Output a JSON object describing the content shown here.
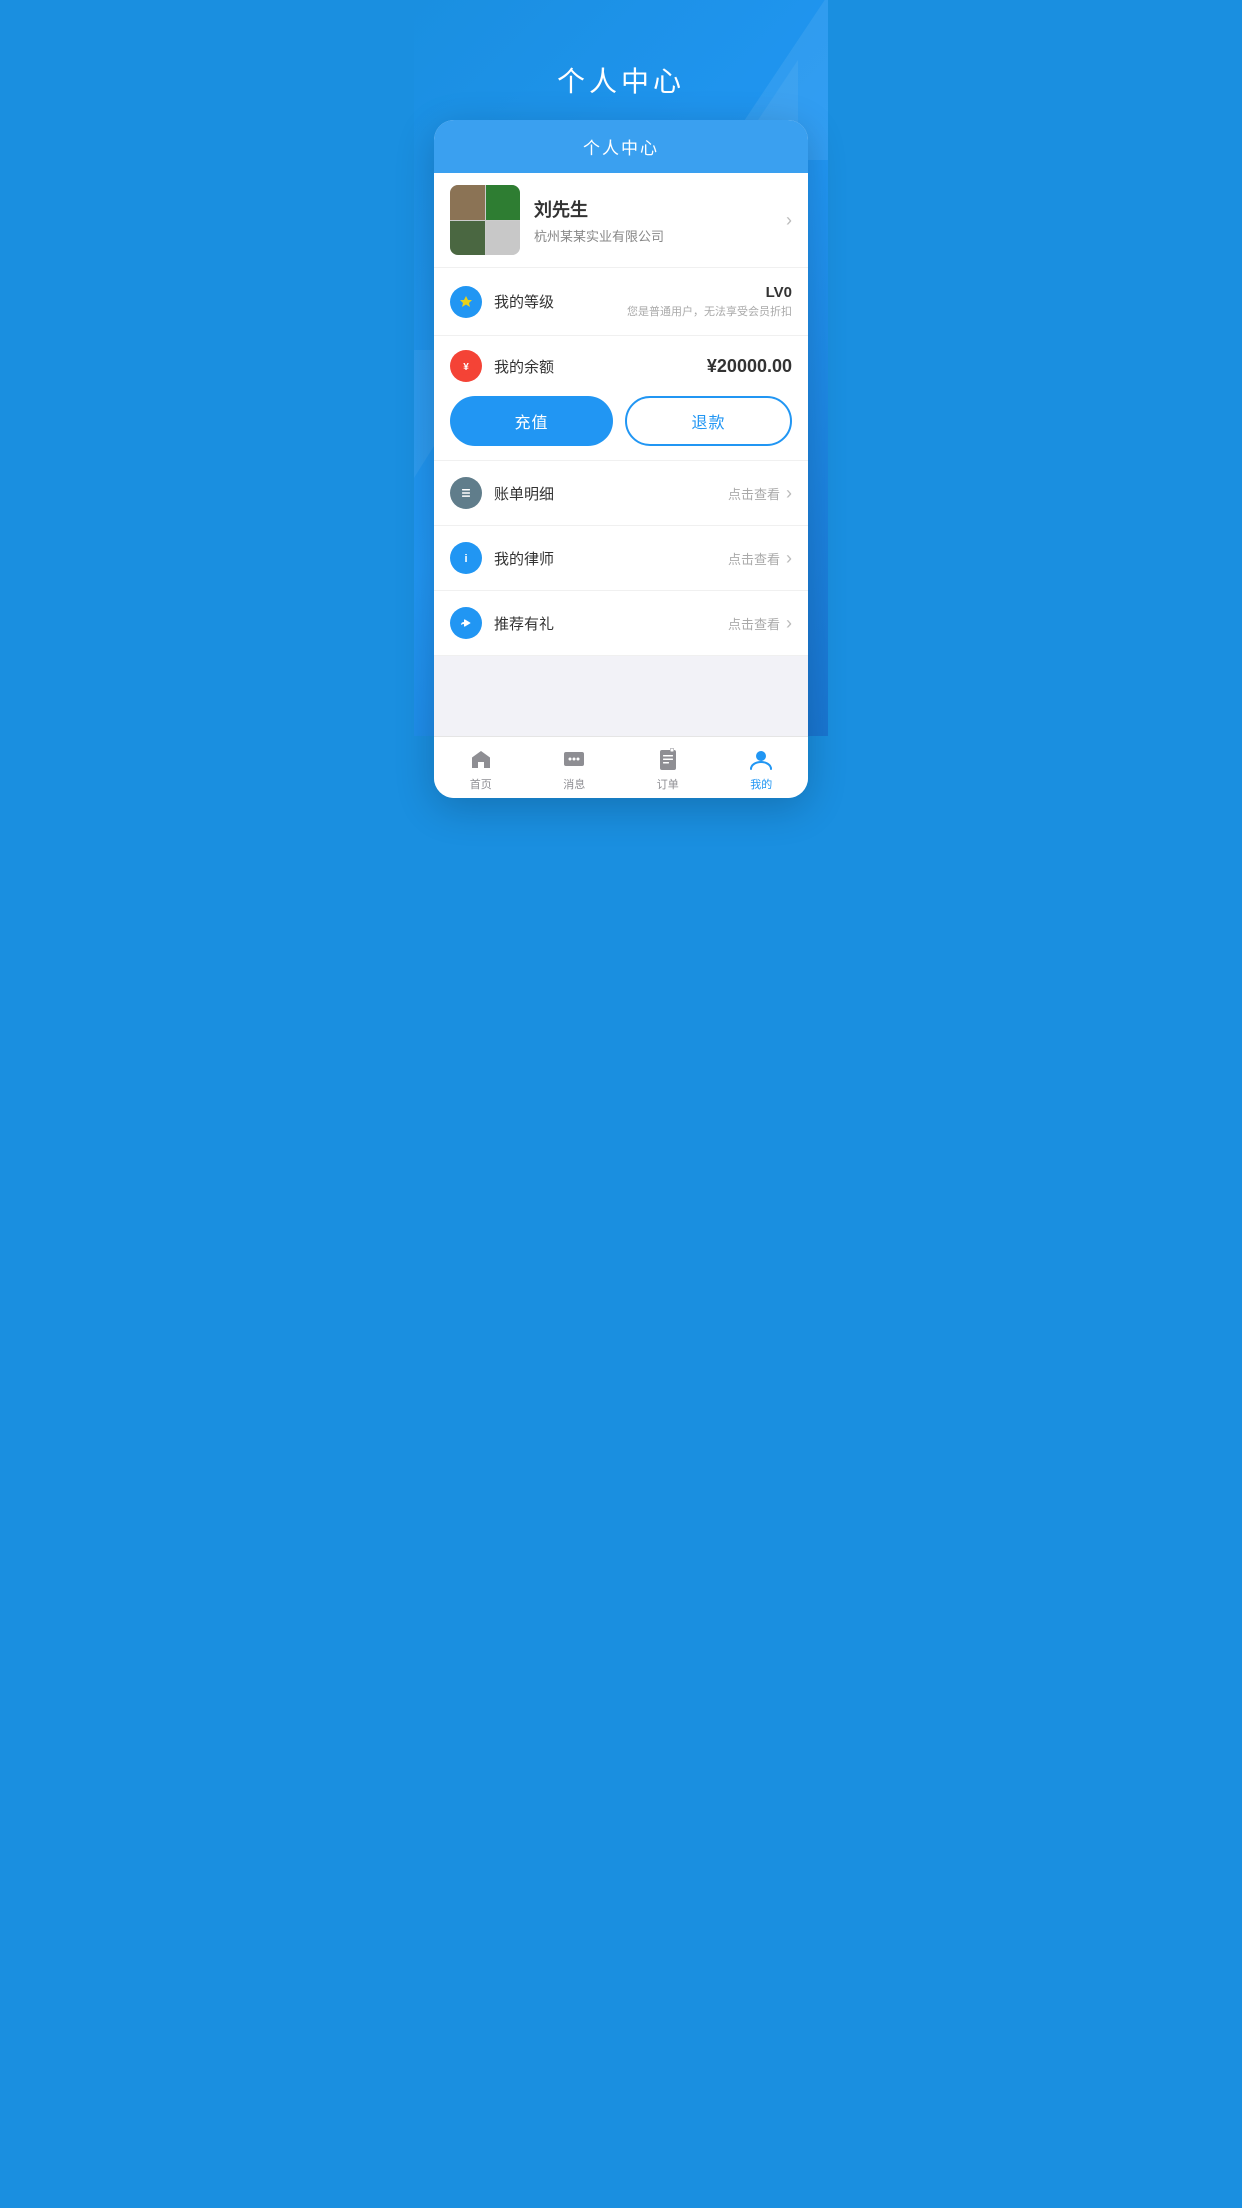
{
  "page": {
    "title": "个人中心",
    "background_color": "#1a8fe0"
  },
  "card": {
    "header_title": "个人中心"
  },
  "user": {
    "name": "刘先生",
    "company": "杭州某某实业有限公司"
  },
  "level": {
    "label": "我的等级",
    "badge": "LV0",
    "description": "您是普通用户，无法享受会员折扣"
  },
  "balance": {
    "label": "我的余额",
    "amount": "¥20000.00",
    "recharge_btn": "充值",
    "refund_btn": "退款"
  },
  "menu_items": [
    {
      "id": "bill",
      "label": "账单明细",
      "right_text": "点击查看"
    },
    {
      "id": "lawyer",
      "label": "我的律师",
      "right_text": "点击查看"
    },
    {
      "id": "recommend",
      "label": "推荐有礼",
      "right_text": "点击查看"
    }
  ],
  "bottom_nav": [
    {
      "id": "home",
      "label": "首页",
      "active": false
    },
    {
      "id": "message",
      "label": "消息",
      "active": false
    },
    {
      "id": "orders",
      "label": "订单",
      "active": false
    },
    {
      "id": "mine",
      "label": "我的",
      "active": true
    }
  ]
}
